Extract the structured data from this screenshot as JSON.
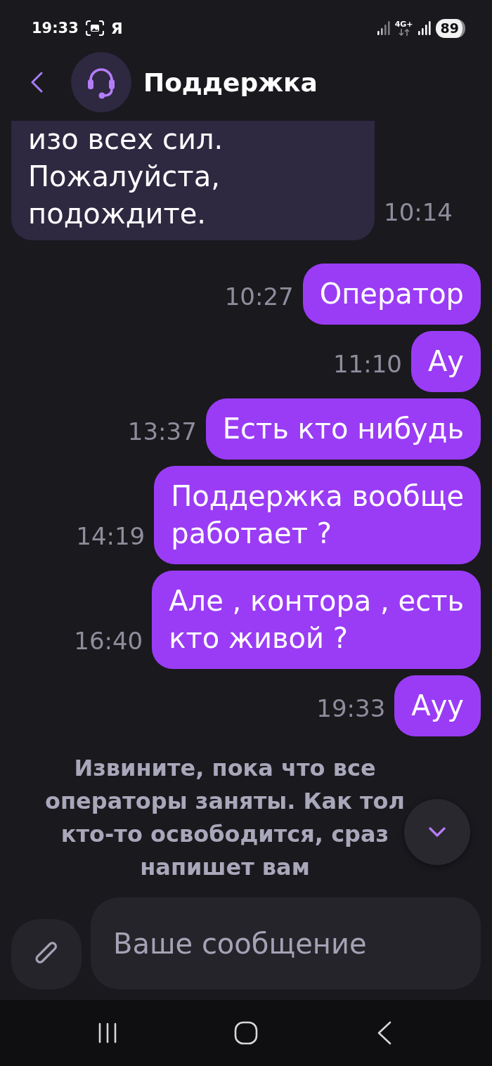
{
  "status_bar": {
    "time": "19:33",
    "notification_letter": "Я",
    "network_type": "4G+",
    "battery": "89"
  },
  "header": {
    "title": "Поддержка"
  },
  "messages": [
    {
      "kind": "incoming",
      "text": "изо всех сил.\nПожалуйста,\nподождите.",
      "time": "10:14"
    },
    {
      "kind": "outgoing",
      "text": "Оператор",
      "time": "10:27"
    },
    {
      "kind": "outgoing",
      "text": "Ау",
      "time": "11:10"
    },
    {
      "kind": "outgoing",
      "text": "Есть кто нибудь",
      "time": "13:37"
    },
    {
      "kind": "outgoing",
      "text": "Поддержка вообще\nработает ?",
      "time": "14:19"
    },
    {
      "kind": "outgoing",
      "text": "Але , контора , есть\nкто живой ?",
      "time": "16:40"
    },
    {
      "kind": "outgoing",
      "text": "Ауу",
      "time": "19:33"
    }
  ],
  "system_message": {
    "text": "Извините, пока что все\nоператоры заняты. Как тол\nкто-то освободится, сраз\nнапишет вам"
  },
  "composer": {
    "placeholder": "Ваше сообщение"
  }
}
